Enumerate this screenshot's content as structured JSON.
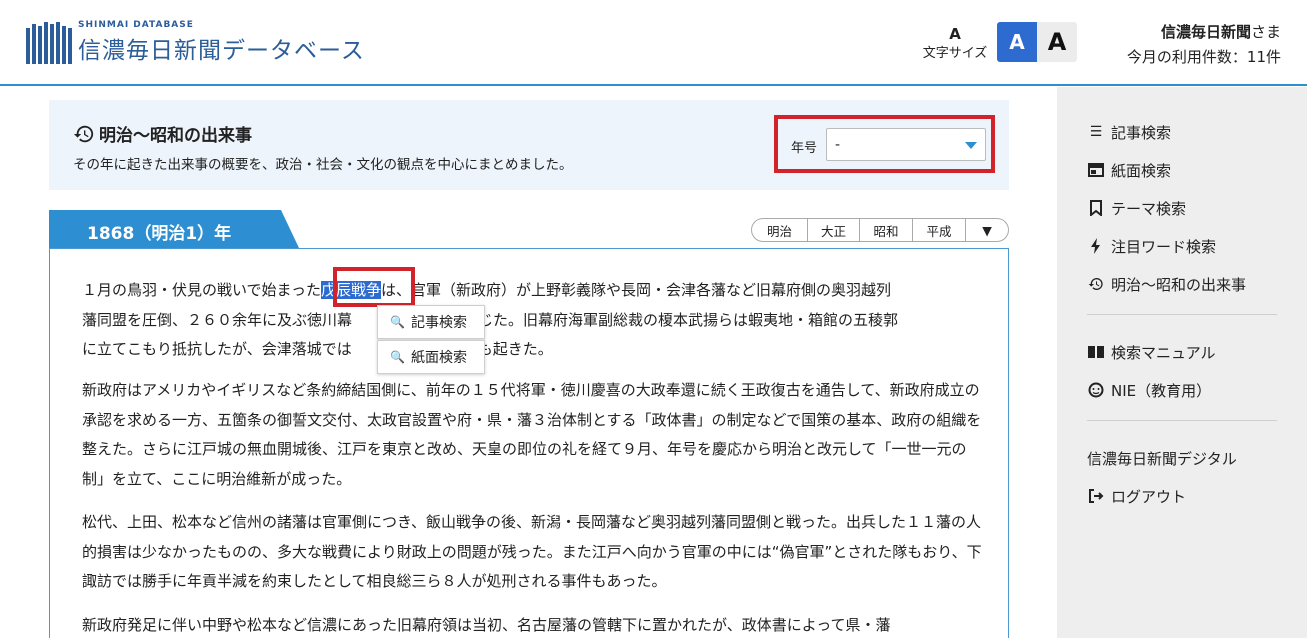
{
  "header": {
    "logo_sub": "SHINMAI DATABASE",
    "logo_main": "信濃毎日新聞データベース",
    "font_size_icon": "A",
    "font_size_label": "文字サイズ",
    "font_small": "A",
    "font_large": "A",
    "user_name": "信濃毎日新聞",
    "user_suffix": "さま",
    "usage": "今月の利用件数：11件"
  },
  "events": {
    "title": "明治〜昭和の出来事",
    "description": "その年に起きた出来事の概要を、政治・社会・文化の観点を中心にまとめました。",
    "era_label": "年号",
    "era_value": "-"
  },
  "year_tab": "1868（明治1）年",
  "era_nav": [
    "明治",
    "大正",
    "昭和",
    "平成",
    "▼"
  ],
  "selection": {
    "text": "戊辰戦争",
    "menu": [
      "記事検索",
      "紙面検索"
    ]
  },
  "paragraphs": {
    "p1_before": "１月の鳥羽・伏見の戦いで始まった",
    "p1_after": "は、官軍（新政府）が上野彰義隊や長岡・会津各藩など旧幕府側の奥羽越列",
    "p1_line2a": "藩同盟を圧倒、２６０余年に及ぶ徳川幕",
    "p1_line2b": "は閉じた。旧幕府海軍副総裁の榎本武揚らは蝦夷地・箱館の五稜郭",
    "p1_line3a": "に立てこもり抵抗したが、会津落城では",
    "p1_line3b": "悲劇も起きた。",
    "p2": "新政府はアメリカやイギリスなど条約締結国側に、前年の１５代将軍・徳川慶喜の大政奉還に続く王政復古を通告して、新政府成立の承認を求める一方、五箇条の御誓文交付、太政官設置や府・県・藩３治体制とする「政体書」の制定などで国策の基本、政府の組織を整えた。さらに江戸城の無血開城後、江戸を東京と改め、天皇の即位の礼を経て９月、年号を慶応から明治と改元して「一世一元の制」を立て、ここに明治維新が成った。",
    "p3": "松代、上田、松本など信州の諸藩は官軍側につき、飯山戦争の後、新潟・長岡藩など奥羽越列藩同盟側と戦った。出兵した１１藩の人的損害は少なかったものの、多大な戦費により財政上の問題が残った。また江戸へ向かう官軍の中には“偽官軍”とされた隊もおり、下諏訪では勝手に年貢半減を約束したとして相良総三ら８人が処刑される事件もあった。",
    "p4": "新政府発足に伴い中野や松本など信濃にあった旧幕府領は当初、名古屋藩の管轄下に置かれたが、政体書によって県・藩"
  },
  "sidebar": {
    "items": [
      {
        "label": "記事検索",
        "icon": "list-icon"
      },
      {
        "label": "紙面検索",
        "icon": "newspaper-icon"
      },
      {
        "label": "テーマ検索",
        "icon": "bookmark-icon"
      },
      {
        "label": "注目ワード検索",
        "icon": "bolt-icon"
      },
      {
        "label": "明治〜昭和の出来事",
        "icon": "history-icon"
      }
    ],
    "items2": [
      {
        "label": "検索マニュアル",
        "icon": "book-icon"
      },
      {
        "label": "NIE（教育用）",
        "icon": "face-icon"
      }
    ],
    "digital": "信濃毎日新聞デジタル",
    "logout": "ログアウト"
  },
  "colors": {
    "accent": "#2d8fd1",
    "highlight_red": "#d1232a",
    "selection_blue": "#2d6bd1"
  }
}
